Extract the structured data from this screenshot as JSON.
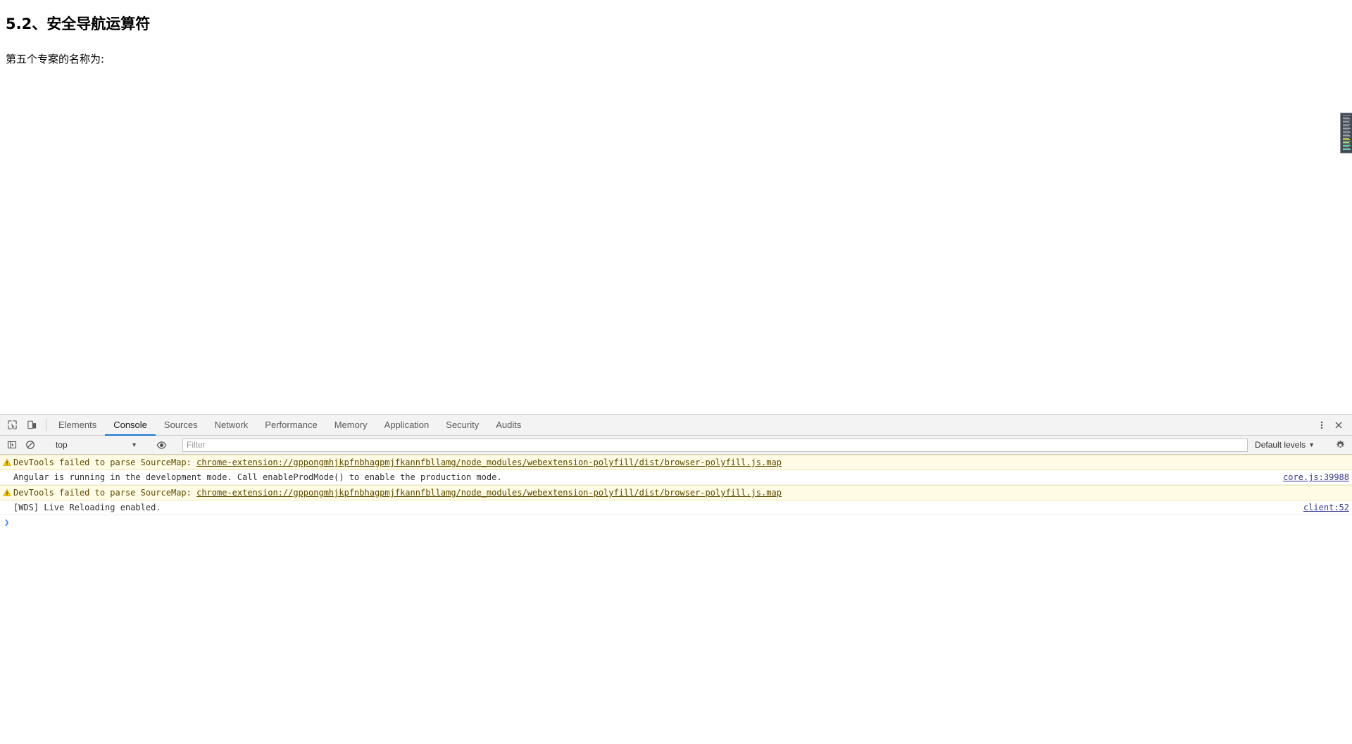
{
  "page": {
    "heading": "5.2、安全导航运算符",
    "paragraph": "第五个专案的名称为:",
    "minimap_icon": "minimap-widget"
  },
  "devtools": {
    "tabbar": {
      "inspect_icon": "inspect-element-icon",
      "device_icon": "device-toolbar-icon",
      "tabs": [
        {
          "label": "Elements",
          "active": false
        },
        {
          "label": "Console",
          "active": true
        },
        {
          "label": "Sources",
          "active": false
        },
        {
          "label": "Network",
          "active": false
        },
        {
          "label": "Performance",
          "active": false
        },
        {
          "label": "Memory",
          "active": false
        },
        {
          "label": "Application",
          "active": false
        },
        {
          "label": "Security",
          "active": false
        },
        {
          "label": "Audits",
          "active": false
        }
      ],
      "more_icon": "kebab-menu-icon",
      "close_icon": "close-icon"
    },
    "console_toolbar": {
      "sidebar_icon": "console-sidebar-icon",
      "clear_icon": "clear-console-icon",
      "context_value": "top",
      "context_caret": "▼",
      "eye_icon": "live-expression-eye-icon",
      "filter_placeholder": "Filter",
      "filter_value": "",
      "levels_label": "Default levels",
      "levels_caret": "▼",
      "settings_icon": "gear-icon"
    },
    "messages": [
      {
        "level": "warning",
        "icon": "warning-triangle-icon",
        "text": "DevTools failed to parse SourceMap: ",
        "link": "chrome-extension://gppongmhjkpfnbhagpmjfkannfbllamg/node_modules/webextension-polyfill/dist/browser-polyfill.js.map",
        "source": ""
      },
      {
        "level": "info",
        "icon": "",
        "text": "Angular is running in the development mode. Call enableProdMode() to enable the production mode.",
        "link": "",
        "source": "core.js:39988"
      },
      {
        "level": "warning",
        "icon": "warning-triangle-icon",
        "text": "DevTools failed to parse SourceMap: ",
        "link": "chrome-extension://gppongmhjkpfnbhagpmjfkannfbllamg/node_modules/webextension-polyfill/dist/browser-polyfill.js.map",
        "source": ""
      },
      {
        "level": "info",
        "icon": "",
        "text": "[WDS] Live Reloading enabled.",
        "link": "",
        "source": "client:52"
      }
    ],
    "prompt": {
      "arrow": "❯"
    }
  },
  "colors": {
    "accent": "#1976d2",
    "warning_bg": "#fffbe5",
    "warning_text": "#5c4a00",
    "link": "#3b3b8f",
    "prompt": "#2979ff",
    "toolbar_bg": "#f3f3f3",
    "minimap_bg": "#434a54"
  }
}
